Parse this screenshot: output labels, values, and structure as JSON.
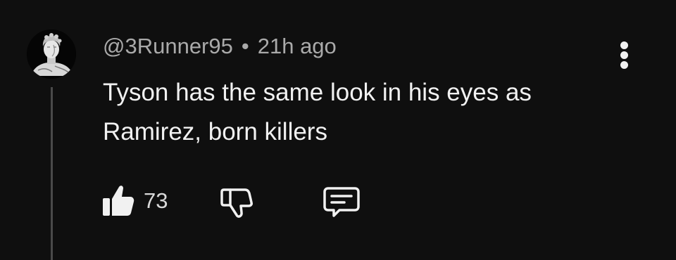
{
  "comment": {
    "author": "@3Runner95",
    "separator": "•",
    "timestamp": "21h ago",
    "text": "Tyson has the same look in his eyes as Ramirez, born killers",
    "like_count": "73",
    "avatar_icon": "classical-bust-avatar",
    "icons": {
      "like": "thumbs-up-icon",
      "dislike": "thumbs-down-icon",
      "reply": "comment-bubble-icon",
      "more": "vertical-dots-icon"
    },
    "colors": {
      "background": "#0f0f0f",
      "primary_text": "#f1f1f1",
      "secondary_text": "#aaaaaa",
      "thread_line": "#4a4a4a"
    }
  }
}
